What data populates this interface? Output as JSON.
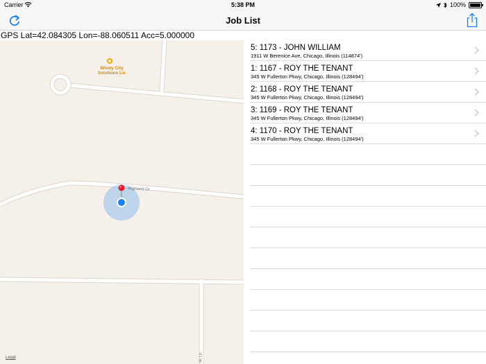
{
  "status_bar": {
    "carrier": "Carrier",
    "time": "5:38 PM",
    "battery": "100%"
  },
  "nav": {
    "title": "Job List"
  },
  "gps": {
    "text": "GPS Lat=42.084305 Lon=-88.060511  Acc=5.000000"
  },
  "map": {
    "poi_name": "Windy City Solutions Llc",
    "road_label": "Highland Dr",
    "road_label_vertical": "ok Ln",
    "legal": "Legal"
  },
  "jobs": [
    {
      "title": "5: 1173 - JOHN WILLIAM",
      "address": "1911 W Berenice Ave, Chicago, Illinois (114874')"
    },
    {
      "title": "1: 1167 - ROY THE TENANT",
      "address": "345 W Fullerton Pkwy, Chicago, Illinois (128494')"
    },
    {
      "title": "2: 1168 - ROY THE TENANT",
      "address": "345 W Fullerton Pkwy, Chicago, Illinois (128494')"
    },
    {
      "title": "3: 1169 - ROY THE TENANT",
      "address": "345 W Fullerton Pkwy, Chicago, Illinois (128494')"
    },
    {
      "title": "4: 1170 - ROY THE TENANT",
      "address": "345 W Fullerton Pkwy, Chicago, Illinois (128494')"
    }
  ],
  "icons": {
    "refresh": "refresh-icon",
    "share": "share-icon",
    "wifi": "wifi-icon",
    "location": "location-arrow-icon",
    "bluetooth": "bluetooth-icon",
    "pin": "map-pin-icon",
    "user_location": "user-location-icon",
    "chevron": "chevron-right-icon"
  },
  "colors": {
    "accent": "#1a7ff0",
    "pin": "#e01f26",
    "map_bg": "#f5f1ea",
    "road": "#ffffff",
    "poi": "#d98a00"
  }
}
